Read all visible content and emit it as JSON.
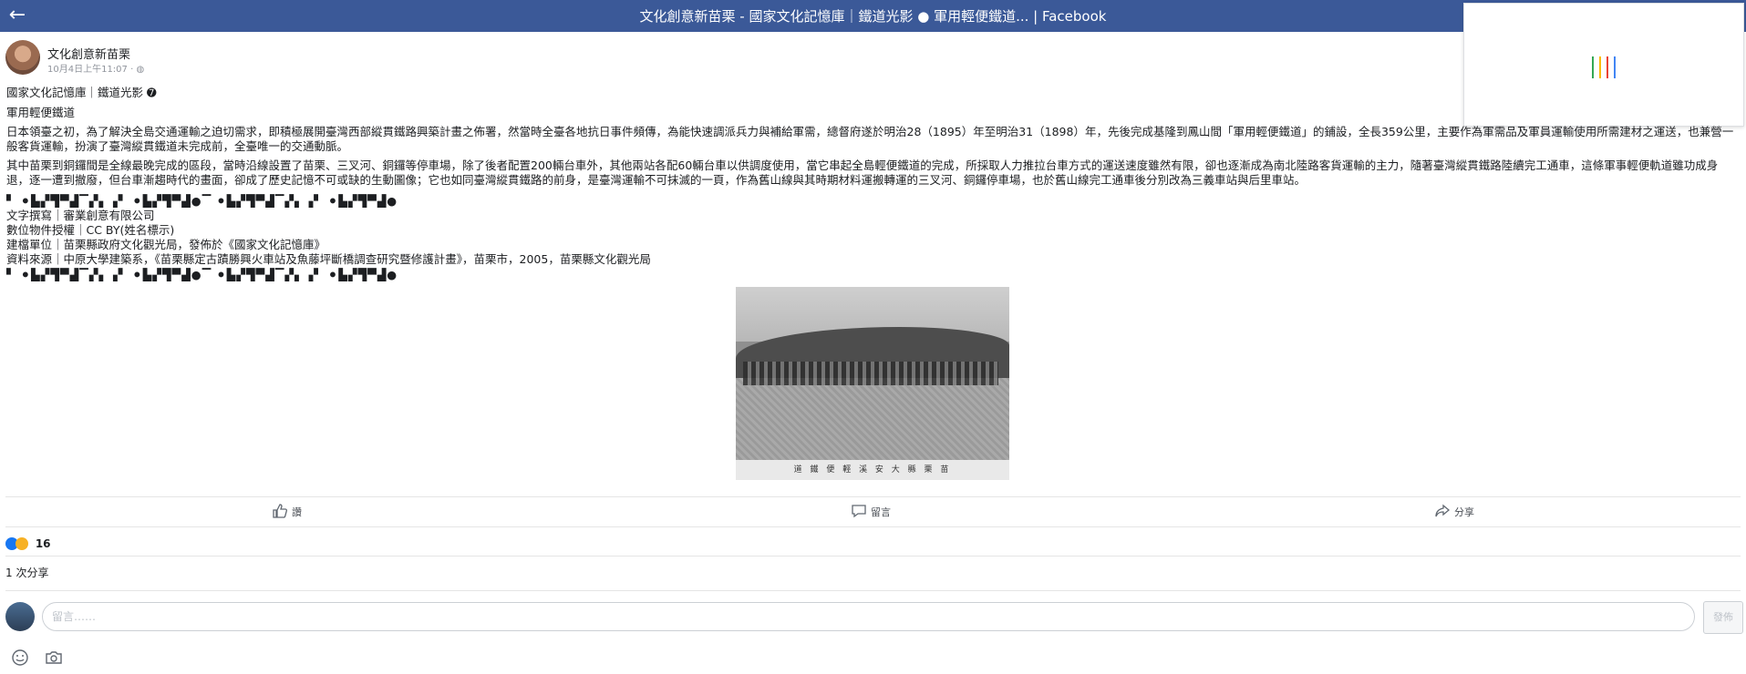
{
  "window": {
    "title": "文化創意新苗栗 - 國家文化記憶庫｜鐵道光影 ● 軍用輕便鐵道... | Facebook",
    "back_icon": "arrow-left-icon"
  },
  "post": {
    "page_name": "文化創意新苗栗",
    "meta": "10月4日上午11:07 · ◍",
    "lines": [
      "國家文化記憶庫｜鐵道光影 ➐",
      "軍用輕便鐵道"
    ],
    "para1": "日本領臺之初，為了解決全島交通運輸之迫切需求，即積極展開臺灣西部縱貫鐵路興築計畫之佈署，然當時全臺各地抗日事件頻傳，為能快速調派兵力與補給軍需，總督府遂於明治28（1895）年至明治31（1898）年，先後完成基隆到鳳山間「軍用輕便鐵道」的鋪設，全長359公里，主要作為軍需品及軍員運輸使用所需建材之運送，也兼營一般客貨運輸，扮演了臺灣縱貫鐵道未完成前，全臺唯一的交通動脈。",
    "para2": "其中苗栗到銅鑼間是全線最晚完成的區段，當時沿線設置了苗栗、三叉河、銅鑼等停車場，除了後者配置200輛台車外，其他兩站各配60輛台車以供調度使用，當它串起全島輕便鐵道的完成，所採取人力推拉台車方式的運送速度雖然有限，卻也逐漸成為南北陸路客貨運輸的主力，隨著臺灣縱貫鐵路陸續完工通車，這條軍事輕便軌道雖功成身退，逐一遭到撤廢，但台車漸趨時代的畫面，卻成了歷史記憶不可或缺的生動圖像；它也如同臺灣縱貫鐵路的前身，是臺灣運輸不可抹滅的一頁，作為舊山線與其時期材料運搬轉運的三叉河、銅鑼停車場，也於舊山線完工通車後分別改為三義車站與后里車站。",
    "emoji_row": "▘ ⚫︎▙▞▜▀▟▔▞▖▗▘ ⚫︎▙▞▜▀▟●▔ ⚫︎▙▞▜▀▟▔▞▖▗▘ ⚫︎▙▞▜▀▟●",
    "credits": [
      "文字撰寫｜審業創意有限公司",
      "數位物件授權｜CC BY(姓名標示)",
      "建檔單位｜苗栗縣政府文化觀光局，發佈於《國家文化記憶庫》",
      "資料來源｜中原大學建築系，《苗栗縣定古蹟勝興火車站及魚藤坪斷橋調查研究暨修護計畫》，苗栗市，2005，苗栗縣文化觀光局"
    ],
    "emoji_row2": "▘ ⚫︎▙▞▜▀▟▔▞▖▗▘ ⚫︎▙▞▜▀▟●▔ ⚫︎▙▞▜▀▟▔▞▖▗▘ ⚫︎▙▞▜▀▟●",
    "photo_caption": "道 鐵 便 輕 溪 安 大 縣 栗 苗"
  },
  "actions": {
    "like": "讚",
    "comment": "留言",
    "share": "分享"
  },
  "stats": {
    "reaction_count": "16",
    "shares": "1 次分享"
  },
  "comment_box": {
    "placeholder": "留言……",
    "send": "發佈"
  },
  "colors": {
    "brand_bar": "#3b5998",
    "like_blue": "#1877f2",
    "haha_yellow": "#f7b125"
  },
  "icons": [
    "arrow-left-icon",
    "thumbs-up-icon",
    "comment-icon",
    "share-icon",
    "smiley-icon",
    "camera-icon"
  ]
}
